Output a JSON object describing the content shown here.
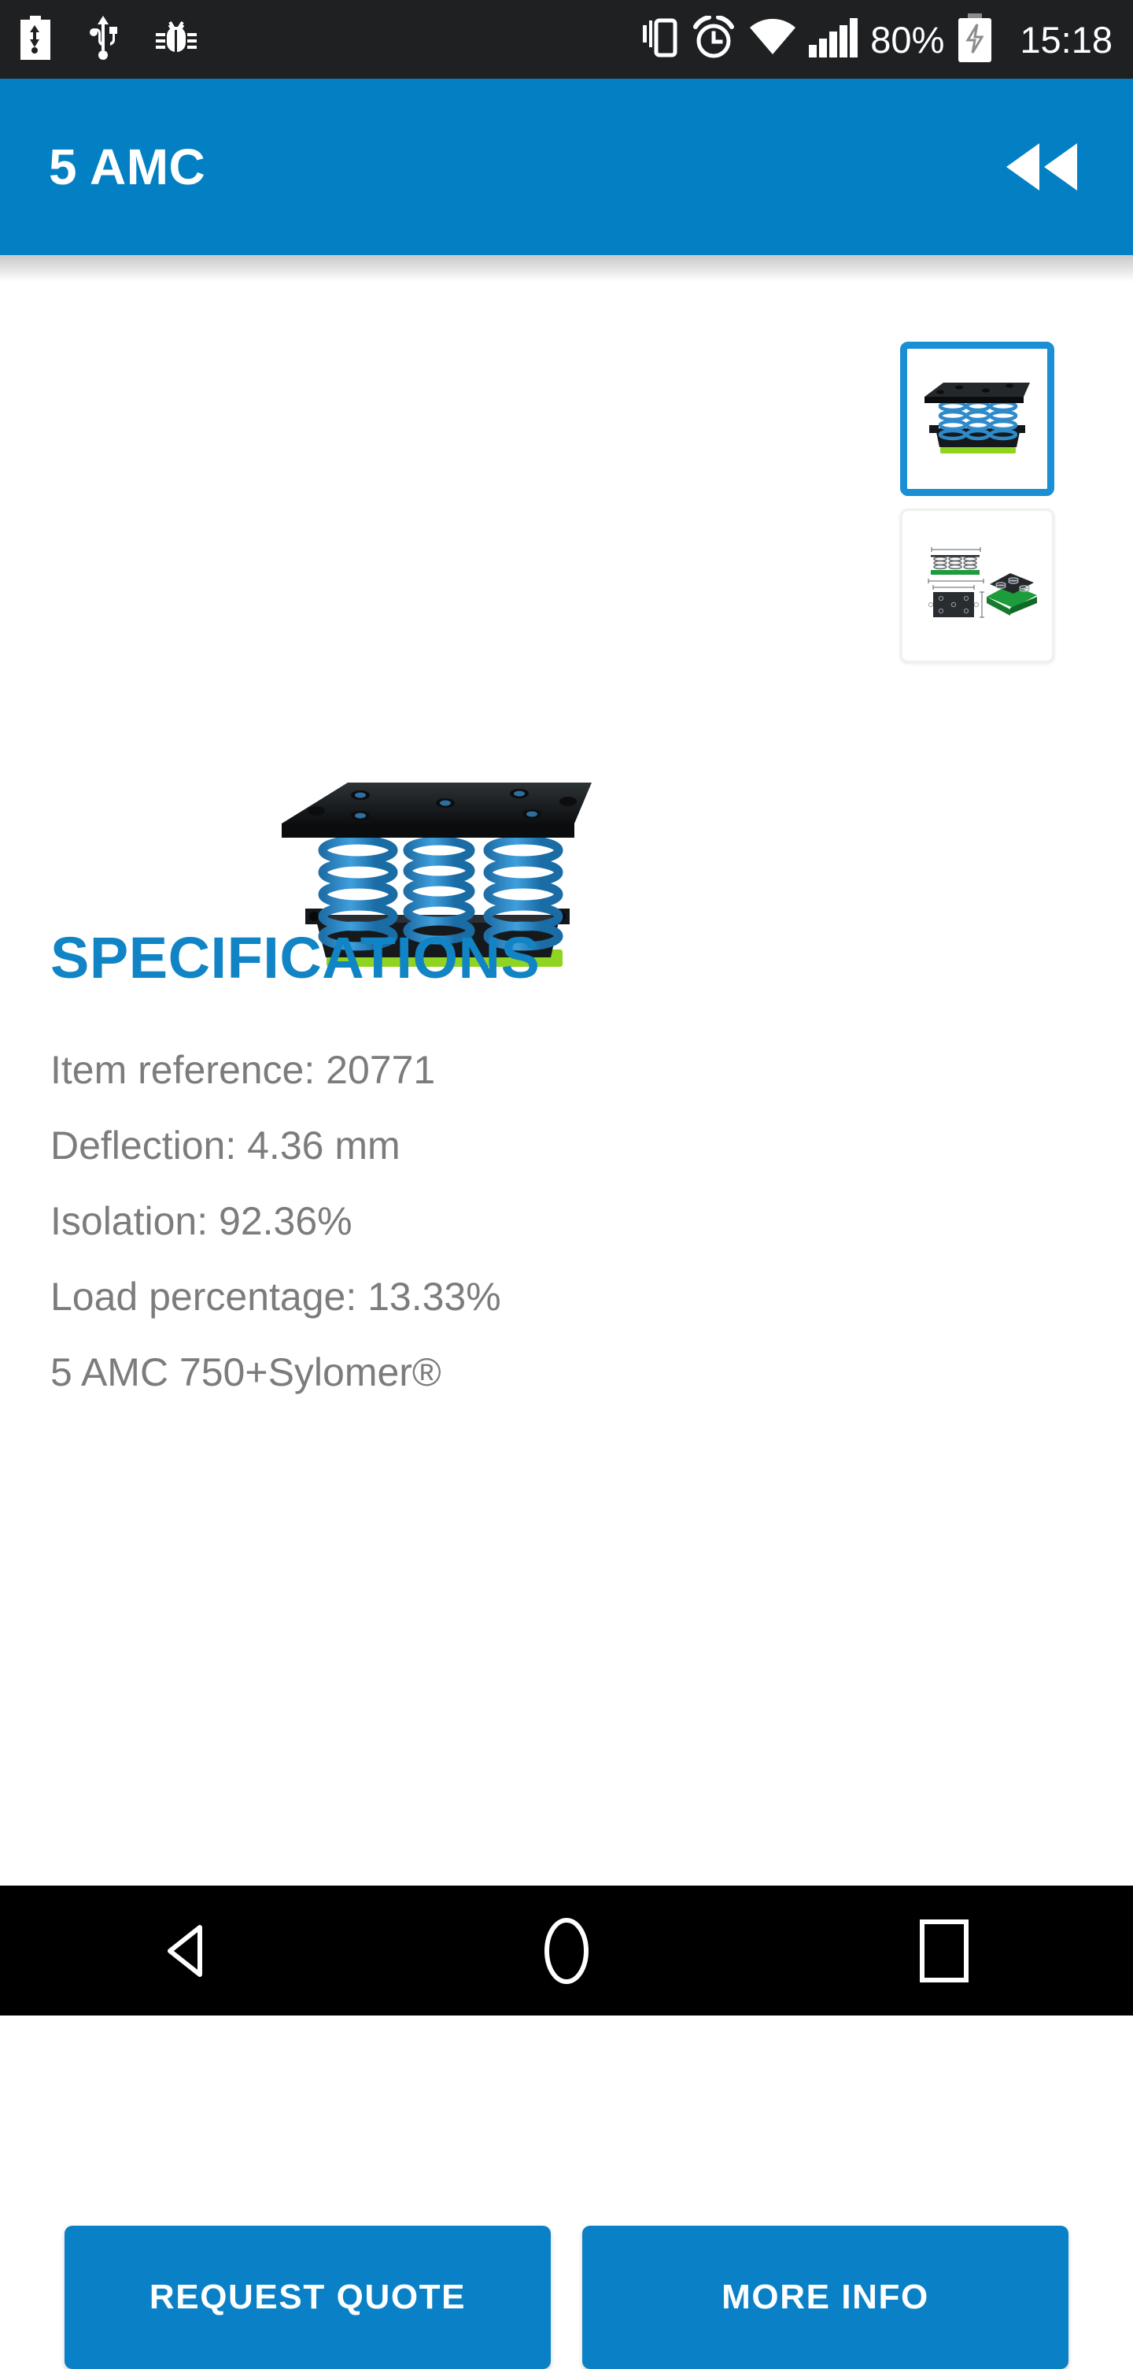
{
  "status_bar": {
    "left_icons": [
      {
        "name": "usb-charging-battery-icon"
      },
      {
        "name": "usb-connection-icon"
      },
      {
        "name": "debug-bug-icon"
      }
    ],
    "right_icons": [
      {
        "name": "vibrate-mode-icon"
      },
      {
        "name": "alarm-clock-icon"
      },
      {
        "name": "wifi-icon"
      },
      {
        "name": "cellular-signal-icon"
      }
    ],
    "battery_percent": "80%",
    "battery_icon": "battery-charging-icon",
    "clock": "15:18",
    "background": "#1e2022",
    "foreground": "#ffffff"
  },
  "app_bar": {
    "title": "5 AMC",
    "action_icon": "rewind-double-left-icon",
    "background": "#0380c4",
    "foreground": "#ffffff"
  },
  "gallery": {
    "hero": {
      "name": "product-photo-spring-isolator",
      "alt": "5 AMC spring vibration isolator with blue springs and green Sylomer pad"
    },
    "thumbnails": [
      {
        "name": "thumbnail-product-photo",
        "selected": true,
        "alt": "Product photo"
      },
      {
        "name": "thumbnail-technical-drawing",
        "selected": false,
        "alt": "Technical drawing with dimensions"
      }
    ],
    "selected_border_color": "#1b8fd4"
  },
  "specifications": {
    "heading": "SPECIFICATIONS",
    "heading_color": "#1184c6",
    "text_color": "#7c7c7c",
    "lines": [
      "Item reference: 20771",
      "Deflection: 4.36 mm",
      "Isolation: 92.36%",
      "Load percentage: 13.33%",
      "5 AMC 750+Sylomer®"
    ],
    "fields": {
      "item_reference": "20771",
      "deflection": "4.36 mm",
      "isolation": "92.36%",
      "load_percentage": "13.33%",
      "model": "5 AMC 750+Sylomer®"
    }
  },
  "actions": {
    "request_quote_label": "REQUEST QUOTE",
    "more_info_label": "MORE INFO",
    "button_color": "#0a81c6",
    "button_text_color": "#ffffff"
  },
  "nav_bar": {
    "back_icon": "back-triangle-icon",
    "home_icon": "home-circle-icon",
    "recents_icon": "recents-square-icon",
    "background": "#000000",
    "foreground": "#ffffff"
  }
}
